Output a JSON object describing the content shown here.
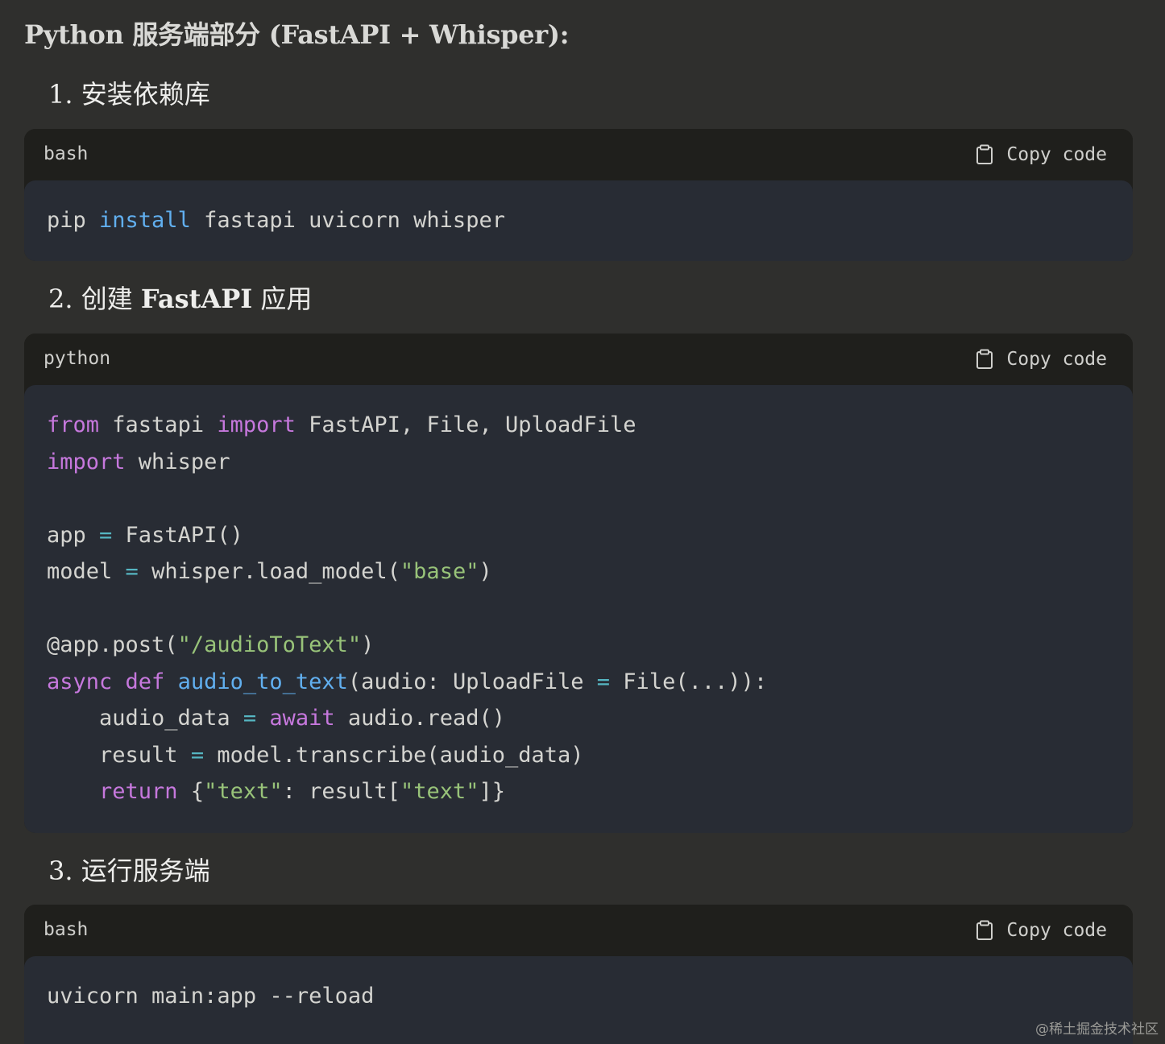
{
  "heading": "Python 服务端部分 (FastAPI + Whisper):",
  "steps": [
    {
      "num": "1.",
      "text": "安装依赖库"
    },
    {
      "num": "2.",
      "text_a": "创建",
      "text_b": "FastAPI",
      "text_c": "应用"
    },
    {
      "num": "3.",
      "text": "运行服务端"
    }
  ],
  "blocks": [
    {
      "lang": "bash",
      "copy_label": "Copy code",
      "lines": [
        [
          {
            "t": "pip "
          },
          {
            "t": "install",
            "c": "fn"
          },
          {
            "t": " fastapi uvicorn whisper"
          }
        ]
      ]
    },
    {
      "lang": "python",
      "copy_label": "Copy code",
      "lines": [
        [
          {
            "t": "from",
            "c": "kw"
          },
          {
            "t": " fastapi "
          },
          {
            "t": "import",
            "c": "kw"
          },
          {
            "t": " FastAPI, File, UploadFile"
          }
        ],
        [
          {
            "t": "import",
            "c": "kw"
          },
          {
            "t": " whisper"
          }
        ],
        [],
        [
          {
            "t": "app "
          },
          {
            "t": "=",
            "c": "op"
          },
          {
            "t": " FastAPI()"
          }
        ],
        [
          {
            "t": "model "
          },
          {
            "t": "=",
            "c": "op"
          },
          {
            "t": " whisper.load_model("
          },
          {
            "t": "\"base\"",
            "c": "str"
          },
          {
            "t": ")"
          }
        ],
        [],
        [
          {
            "t": "@app.post("
          },
          {
            "t": "\"/audioToText\"",
            "c": "str"
          },
          {
            "t": ")"
          }
        ],
        [
          {
            "t": "async",
            "c": "kw"
          },
          {
            "t": " "
          },
          {
            "t": "def",
            "c": "kw"
          },
          {
            "t": " "
          },
          {
            "t": "audio_to_text",
            "c": "fn"
          },
          {
            "t": "(audio: UploadFile "
          },
          {
            "t": "=",
            "c": "op"
          },
          {
            "t": " File(...)):"
          }
        ],
        [
          {
            "t": "    audio_data "
          },
          {
            "t": "=",
            "c": "op"
          },
          {
            "t": " "
          },
          {
            "t": "await",
            "c": "kw"
          },
          {
            "t": " audio.read()"
          }
        ],
        [
          {
            "t": "    result "
          },
          {
            "t": "=",
            "c": "op"
          },
          {
            "t": " model.transcribe(audio_data)"
          }
        ],
        [
          {
            "t": "    "
          },
          {
            "t": "return",
            "c": "kw"
          },
          {
            "t": " {"
          },
          {
            "t": "\"text\"",
            "c": "str"
          },
          {
            "t": ": result["
          },
          {
            "t": "\"text\"",
            "c": "str"
          },
          {
            "t": "]}"
          }
        ]
      ]
    },
    {
      "lang": "bash",
      "copy_label": "Copy code",
      "lines": [
        [
          {
            "t": "uvicorn main:app --reload"
          }
        ]
      ]
    }
  ],
  "watermark": "@稀土掘金技术社区",
  "colors": {
    "page_bg": "#2f2f2d",
    "header_bg": "#1f1f1c",
    "code_bg": "#282c34",
    "keyword": "#c678dd",
    "function": "#61afef",
    "string": "#98c379",
    "operator": "#56b6c2"
  },
  "icons": {
    "copy": "clipboard-icon"
  }
}
